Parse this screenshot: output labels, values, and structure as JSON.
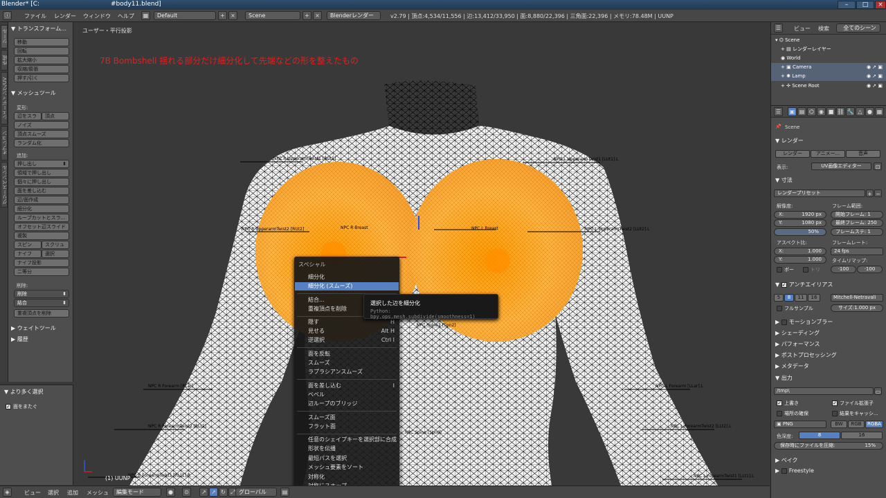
{
  "titlebar": {
    "title": "Blender* [C:",
    "filename": "#body11.blend]"
  },
  "menubar": {
    "menus": [
      "ファイル",
      "レンダー",
      "ウィンドウ",
      "ヘルプ"
    ],
    "layout": "Default",
    "scene": "Scene",
    "engine": "Blenderレンダー",
    "stats": "v2.79 | 頂点:4,534/11,556 | 辺:13,412/33,950 | 面:8,880/22,396 | 三角面:22,396 | メモリ:78.48M | UUNP"
  },
  "lefttabs": [
    "ツール",
    "作成",
    "シェーディング/UV",
    "オプション",
    "グリースペンシル"
  ],
  "toolshelf": {
    "transform_header": "▼ トランスフォーム...",
    "transform_buttons": [
      "移動",
      "回転",
      "拡大縮小",
      "収縮/膨張",
      "押す/引く"
    ],
    "meshtools_header": "▼ メッシュツール",
    "deform_label": "変形:",
    "deform_row": [
      "辺をスラ",
      "頂点"
    ],
    "deform_buttons": [
      "ノイズ",
      "頂点スムーズ",
      "ランダム化"
    ],
    "add_label": "追加:",
    "extrude": "押し出し",
    "add_buttons": [
      "領域で押し出し",
      "個々に押し出し",
      "面を差し込む",
      "辺/面作成",
      "細分化",
      "ループカットとスラ...",
      "オフセット辺スライド",
      "複製"
    ],
    "spin_row": [
      "スピン",
      "スクリュ"
    ],
    "knife_row": [
      "ナイフ",
      "選択"
    ],
    "knife_project": "ナイフ投影",
    "bisect": "二等分",
    "delete_label": "削除:",
    "delete": "削除",
    "merge": "結合",
    "remove_doubles": "重複頂点を削除",
    "weight_tools": "▶ ウェイトツール",
    "history": "▶ 履歴"
  },
  "lastop": {
    "header": "▼ より多く選択",
    "face_step": "面をまたぐ"
  },
  "viewport": {
    "label": "ユーザー・平行投影",
    "annotation": "7B Bombshell 揺れる部分だけ細分化して先端などの形を整えたもの",
    "object": "(1) UUNP",
    "bones": [
      {
        "text": "NPC R UpperarmTwist1 [RUt1]"
      },
      {
        "text": "NPC L UpperarmTwist1 [LUt1].L"
      },
      {
        "text": "NPC R UpperarmTwist2 [RUt2]"
      },
      {
        "text": "NPC R Breast"
      },
      {
        "text": "NPC L Breast"
      },
      {
        "text": "NPC L UpperarmTwist2 [LUt2].L"
      },
      {
        "text": "NPC Spine2 [Spn2]"
      },
      {
        "text": "NPC R Forearm [RLar]"
      },
      {
        "text": "NPC L Forearm [LLar].L"
      },
      {
        "text": "NPC R ForearmTwist2 [RLt2]"
      },
      {
        "text": "NPC L ForearmTwist2 [LLt2].L"
      },
      {
        "text": "NPC Spine [Spn0]"
      },
      {
        "text": "NPC R ForearmTwist1 [RLt1].R"
      },
      {
        "text": "NPC L ForearmTwist1 [LLt1].L"
      }
    ]
  },
  "context_menu": {
    "title": "スペシャル",
    "items": [
      {
        "label": "細分化",
        "shortcut": ""
      },
      {
        "label": "細分化 (スムーズ)",
        "shortcut": ""
      },
      {
        "label": "結合...",
        "shortcut": ""
      },
      {
        "label": "重複頂点を削除",
        "shortcut": ""
      },
      {
        "label": "隠す",
        "shortcut": "H"
      },
      {
        "label": "見せる",
        "shortcut": "Alt H"
      },
      {
        "label": "逆選択",
        "shortcut": "Ctrl I"
      },
      {
        "label": "面を反転",
        "shortcut": ""
      },
      {
        "label": "スムーズ",
        "shortcut": ""
      },
      {
        "label": "ラプラシアンスムーズ",
        "shortcut": ""
      },
      {
        "label": "面を差し込む",
        "shortcut": "I"
      },
      {
        "label": "ベベル",
        "shortcut": ""
      },
      {
        "label": "辺ループのブリッジ",
        "shortcut": ""
      },
      {
        "label": "スムーズ面",
        "shortcut": ""
      },
      {
        "label": "フラット面",
        "shortcut": ""
      },
      {
        "label": "任意のシェイプキーを選択部に合成",
        "shortcut": ""
      },
      {
        "label": "形状を伝播",
        "shortcut": ""
      },
      {
        "label": "最短パスを選択",
        "shortcut": ""
      },
      {
        "label": "メッシュ要素をソート",
        "shortcut": ""
      },
      {
        "label": "対称化",
        "shortcut": ""
      },
      {
        "label": "対称にスナップ",
        "shortcut": ""
      }
    ]
  },
  "tooltip": {
    "title": "選択した辺を細分化",
    "python": "Python: bpy.ops.mesh.subdivide(smoothness=1)"
  },
  "vpheader": {
    "menus": [
      "ビュー",
      "選択",
      "追加",
      "メッシュ"
    ],
    "mode": "編集モード",
    "orientation": "グローバル"
  },
  "outliner": {
    "tabs": [
      "ビュー",
      "検索",
      "全てのシーン"
    ],
    "items": [
      "Scene",
      "レンダーレイヤー",
      "World",
      "Camera",
      "Lamp",
      "Scene Root"
    ]
  },
  "properties": {
    "scene_label": "Scene",
    "render_header": "▼ レンダー",
    "render_btns": [
      "レンダー",
      "アニメー...",
      "音声"
    ],
    "display_label": "表示:",
    "display_value": "UV画像エディター",
    "dimensions_header": "▼ 寸法",
    "render_preset": "レンダープリセット",
    "resolution_label": "解像度:",
    "res_x": "X:",
    "res_x_val": "1920 px",
    "res_y": "Y:",
    "res_y_val": "1080 px",
    "res_pct": "50%",
    "frame_range_label": "フレーム範囲:",
    "start_frame": "開始フレーム: 1",
    "end_frame": "最終フレーム: 250",
    "frame_step": "フレームステ: 1",
    "aspect_label": "アスペクト比:",
    "asp_x": "X:",
    "asp_x_val": "1.000",
    "asp_y": "Y:",
    "asp_y_val": "1.000",
    "frame_rate_label": "フレームレート:",
    "fps": "24 fps",
    "time_remap": "タイムリマップ:",
    "remap_old": "·100",
    "remap_new": "·100",
    "border": "ボー",
    "crop": "トリ",
    "aa_header": "アンチエイリアス",
    "aa_samples": [
      "5",
      "8",
      "11",
      "16"
    ],
    "aa_filter": "Mitchell-Netravali",
    "full_sample": "フルサンプル",
    "aa_size": "サイズ:1.000 px",
    "motion_blur": "モーションブラー",
    "shading": "▶ シェーディング",
    "performance": "▶ パフォーマンス",
    "post_processing": "▶ ポストプロセッシング",
    "metadata": "▶ メタデータ",
    "output_header": "▼ 出力",
    "output_path": "/tmp\\",
    "overwrite": "上書き",
    "file_ext": "ファイル拡張子",
    "placeholders": "場所の確保",
    "cache_result": "結果をキャッシ...",
    "format": "PNG",
    "color_modes": [
      "BW",
      "RGB",
      "RGBA"
    ],
    "color_depth_label": "色深度:",
    "color_depths": [
      "8",
      "16"
    ],
    "compression": "保存時にファイルを圧縮:",
    "compression_val": "15%",
    "bake": "▶ ベイク",
    "freestyle": "Freestyle"
  }
}
